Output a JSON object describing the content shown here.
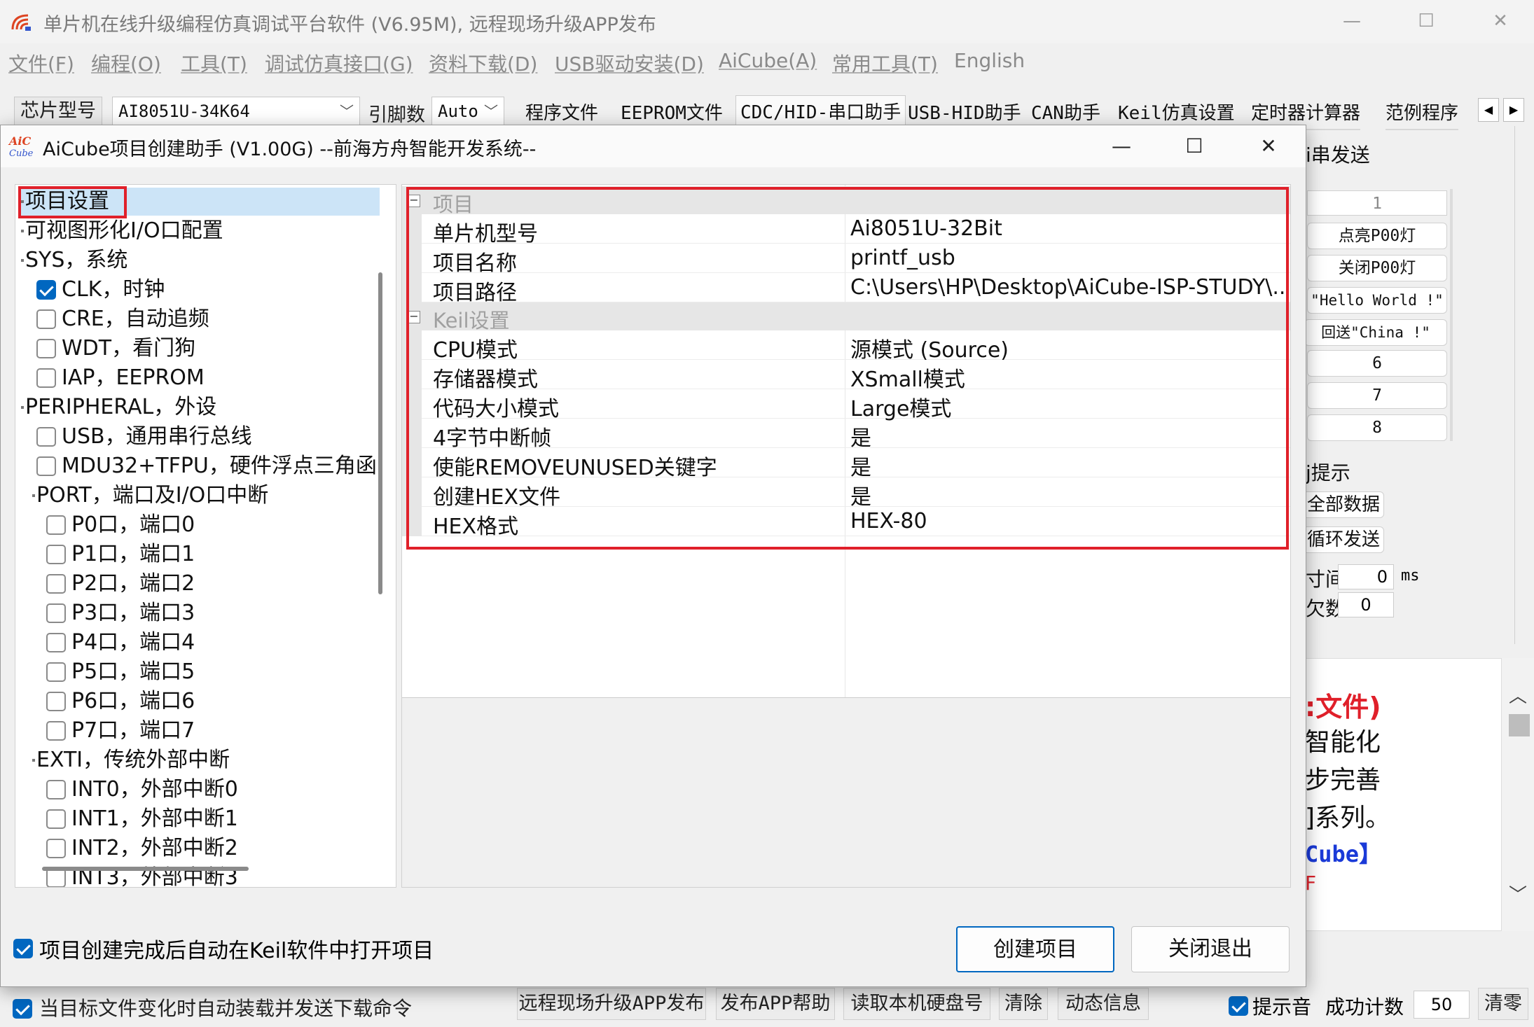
{
  "main_window": {
    "title": "单片机在线升级编程仿真调试平台软件 (V6.95M), 远程现场升级APP发布",
    "menu": [
      "文件(F)",
      "编程(O)",
      "工具(T)",
      "调试仿真接口(G)",
      "资料下载(D)",
      "USB驱动安装(D)",
      "AiCube(A)",
      "常用工具(T)",
      "English"
    ],
    "toolbar": {
      "chip_label": "芯片型号",
      "chip_value": "AI8051U-34K64",
      "pin_label": "引脚数",
      "pin_value": "Auto",
      "tabs": [
        "程序文件",
        "EEPROM文件",
        "CDC/HID-串口助手",
        "USB-HID助手",
        "CAN助手",
        "Keil仿真设置",
        "定时器计算器",
        "范例程序"
      ]
    },
    "right_panel": {
      "header_fragment": "i串发送",
      "send_buttons": [
        "1",
        "点亮P00灯",
        "关闭P00灯",
        "\"Hello World !\"",
        "回送\"China !\"",
        "6",
        "7",
        "8"
      ],
      "hint_fragment": "j提示",
      "all_data_btn": "全部数据",
      "loop_send_btn": "循环发送",
      "interval_fragment": "寸间",
      "interval_value": "0",
      "interval_unit": "ms",
      "count_fragment": "欠数",
      "count_value": "0",
      "text_lines": [
        ":文件)",
        "智能化",
        "步完善",
        "]系列。",
        "Cube】",
        "F"
      ]
    },
    "bottom_bar": {
      "auto_load_label": "当目标文件变化时自动装载并发送下载命令",
      "buttons": [
        "远程现场升级APP发布",
        "发布APP帮助",
        "读取本机硬盘号",
        "清除",
        "动态信息"
      ],
      "beep_label": "提示音",
      "success_count_label": "成功计数",
      "success_count_value": "50",
      "clear_btn": "清零"
    }
  },
  "dialog": {
    "title": "AiCube项目创建助手 (V1.00G) --前海方舟智能开发系统--",
    "tree": [
      {
        "label": "项目设置",
        "level": 0,
        "checkbox": null,
        "selected": true
      },
      {
        "label": "可视图形化I/O口配置",
        "level": 0,
        "checkbox": null
      },
      {
        "label": "SYS，系统",
        "level": 0,
        "checkbox": null
      },
      {
        "label": "CLK，时钟",
        "level": 1,
        "checkbox": true
      },
      {
        "label": "CRE，自动追频",
        "level": 1,
        "checkbox": false
      },
      {
        "label": "WDT，看门狗",
        "level": 1,
        "checkbox": false
      },
      {
        "label": "IAP，EEPROM",
        "level": 1,
        "checkbox": false
      },
      {
        "label": "PERIPHERAL，外设",
        "level": 0,
        "checkbox": null
      },
      {
        "label": "USB，通用串行总线",
        "level": 1,
        "checkbox": false
      },
      {
        "label": "MDU32+TFPU，硬件浮点三角函",
        "level": 1,
        "checkbox": false
      },
      {
        "label": "PORT，端口及I/O口中断",
        "level": 1,
        "checkbox": null
      },
      {
        "label": "P0口，端口0",
        "level": 2,
        "checkbox": false
      },
      {
        "label": "P1口，端口1",
        "level": 2,
        "checkbox": false
      },
      {
        "label": "P2口，端口2",
        "level": 2,
        "checkbox": false
      },
      {
        "label": "P3口，端口3",
        "level": 2,
        "checkbox": false
      },
      {
        "label": "P4口，端口4",
        "level": 2,
        "checkbox": false
      },
      {
        "label": "P5口，端口5",
        "level": 2,
        "checkbox": false
      },
      {
        "label": "P6口，端口6",
        "level": 2,
        "checkbox": false
      },
      {
        "label": "P7口，端口7",
        "level": 2,
        "checkbox": false
      },
      {
        "label": "EXTI，传统外部中断",
        "level": 1,
        "checkbox": null
      },
      {
        "label": "INT0，外部中断0",
        "level": 2,
        "checkbox": false
      },
      {
        "label": "INT1，外部中断1",
        "level": 2,
        "checkbox": false
      },
      {
        "label": "INT2，外部中断2",
        "level": 2,
        "checkbox": false
      },
      {
        "label": "INT3，外部中断3",
        "level": 2,
        "checkbox": false
      }
    ],
    "property_grid": {
      "categories": [
        {
          "label": "项目",
          "props": [
            {
              "name": "单片机型号",
              "value": "Ai8051U-32Bit"
            },
            {
              "name": "项目名称",
              "value": "printf_usb"
            },
            {
              "name": "项目路径",
              "value": "C:\\Users\\HP\\Desktop\\AiCube-ISP-STUDY\\..."
            }
          ]
        },
        {
          "label": "Keil设置",
          "props": [
            {
              "name": "CPU模式",
              "value": "源模式 (Source)"
            },
            {
              "name": "存储器模式",
              "value": "XSmall模式"
            },
            {
              "name": "代码大小模式",
              "value": "Large模式"
            },
            {
              "name": "4字节中断帧",
              "value": "是"
            },
            {
              "name": "使能REMOVEUNUSED关键字",
              "value": "是"
            },
            {
              "name": "创建HEX文件",
              "value": "是"
            },
            {
              "name": "HEX格式",
              "value": "HEX-80"
            }
          ]
        }
      ]
    },
    "auto_open_label": "项目创建完成后自动在Keil软件中打开项目",
    "auto_open_checked": true,
    "create_btn": "创建项目",
    "close_btn": "关闭退出"
  },
  "colors": {
    "accent": "#0067c0",
    "highlight_box": "#e0202a",
    "selection": "#cce4f7"
  }
}
